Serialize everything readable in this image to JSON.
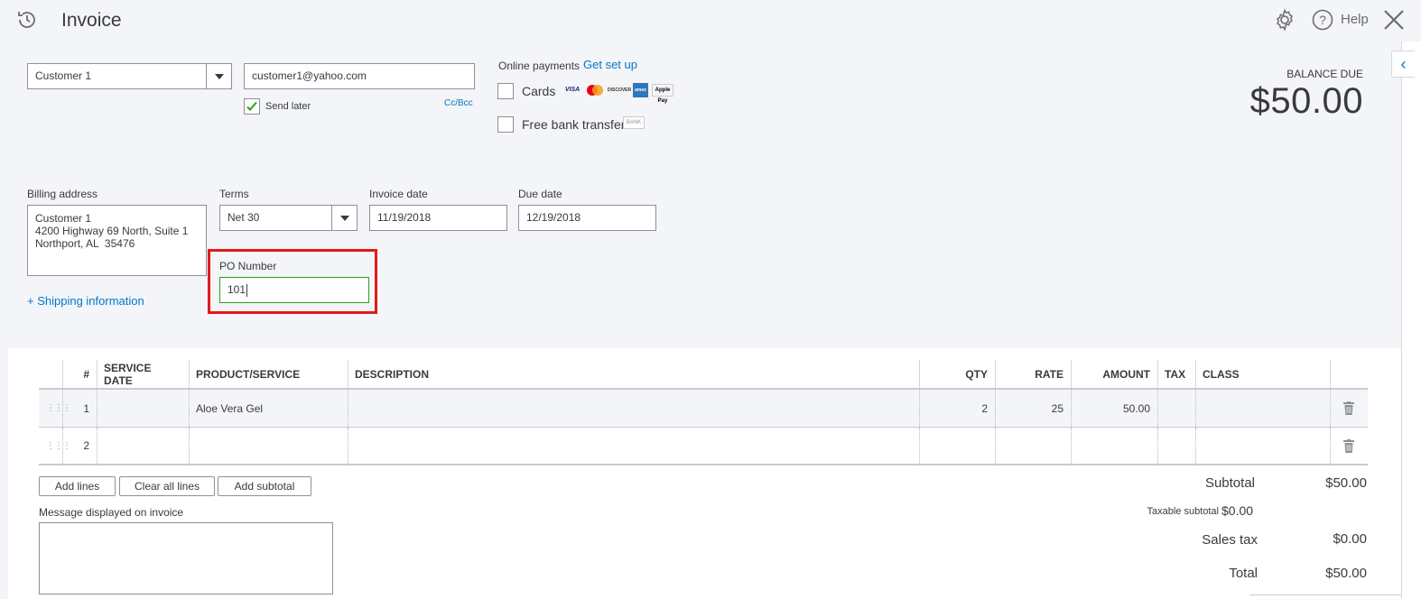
{
  "header": {
    "title": "Invoice",
    "help_label": "Help"
  },
  "customer": {
    "name": "Customer 1",
    "email": "customer1@yahoo.com",
    "send_later_label": "Send later",
    "send_later_checked": true,
    "cc_bcc_label": "Cc/Bcc"
  },
  "online_payments": {
    "label": "Online payments",
    "setup_link": "Get set up",
    "cards_label": "Cards",
    "card_brands": [
      "VISA",
      "mastercard",
      "DISCOVER",
      "amex",
      "Apple Pay"
    ],
    "bank_label": "Free bank transfer",
    "bank_badge": "BANK"
  },
  "balance": {
    "label": "BALANCE DUE",
    "amount": "$50.00"
  },
  "billing": {
    "label": "Billing address",
    "line1": "Customer 1",
    "line2": "4200 Highway 69 North, Suite 1",
    "line3": "Northport, AL  35476"
  },
  "terms": {
    "label": "Terms",
    "value": "Net 30"
  },
  "invoice_date": {
    "label": "Invoice date",
    "value": "11/19/2018"
  },
  "due_date": {
    "label": "Due date",
    "value": "12/19/2018"
  },
  "po": {
    "label": "PO Number",
    "value": "101"
  },
  "shipping_link": "+ Shipping information",
  "table": {
    "headers": {
      "num": "#",
      "service_date": "SERVICE DATE",
      "product": "PRODUCT/SERVICE",
      "description": "DESCRIPTION",
      "qty": "QTY",
      "rate": "RATE",
      "amount": "AMOUNT",
      "tax": "TAX",
      "class": "CLASS"
    },
    "rows": [
      {
        "num": "1",
        "service_date": "",
        "product": "Aloe Vera Gel",
        "description": "",
        "qty": "2",
        "rate": "25",
        "amount": "50.00",
        "tax": "",
        "class": ""
      },
      {
        "num": "2",
        "service_date": "",
        "product": "",
        "description": "",
        "qty": "",
        "rate": "",
        "amount": "",
        "tax": "",
        "class": ""
      }
    ]
  },
  "buttons": {
    "add_lines": "Add lines",
    "clear_all": "Clear all lines",
    "add_subtotal": "Add subtotal"
  },
  "message": {
    "label": "Message displayed on invoice"
  },
  "totals": {
    "subtotal_label": "Subtotal",
    "subtotal": "$50.00",
    "taxable_label": "Taxable subtotal",
    "taxable": "$0.00",
    "sales_tax_label": "Sales tax",
    "sales_tax": "$0.00",
    "total_label": "Total",
    "total": "$50.00"
  },
  "colors": {
    "link": "#0077c5",
    "highlight": "#e21a1a",
    "focus": "#2ca01c",
    "check": "#2ca01c"
  }
}
